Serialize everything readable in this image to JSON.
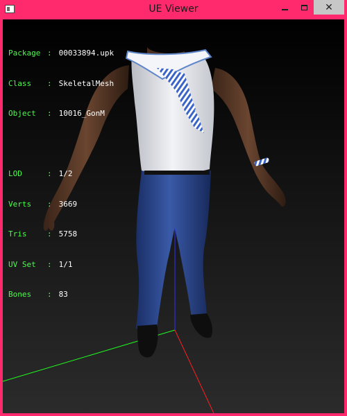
{
  "window": {
    "title": "UE Viewer",
    "controls": {
      "minimize": "–",
      "maximize": "□",
      "close": "✕"
    },
    "frame_color": "#ff2a6d"
  },
  "info": {
    "package_label": "Package",
    "package": "00033894.upk",
    "class_label": "Class",
    "class": "SkeletalMesh",
    "object_label": "Object",
    "object": "10016_GonM",
    "lod_label": "LOD",
    "lod": "1/2",
    "verts_label": "Verts",
    "verts": "3669",
    "tris_label": "Tris",
    "tris": "5758",
    "uvset_label": "UV Set",
    "uvset": "1/1",
    "bones_label": "Bones",
    "bones": "83",
    "label_color": "#49ff49",
    "value_color": "#ffffff"
  },
  "viewport": {
    "model": "character in white sleeveless sailor top with blue striped scarf and blue jeans",
    "axis_colors": {
      "x": "#ff2020",
      "y": "#20ff20",
      "z": "#3030ff"
    }
  }
}
